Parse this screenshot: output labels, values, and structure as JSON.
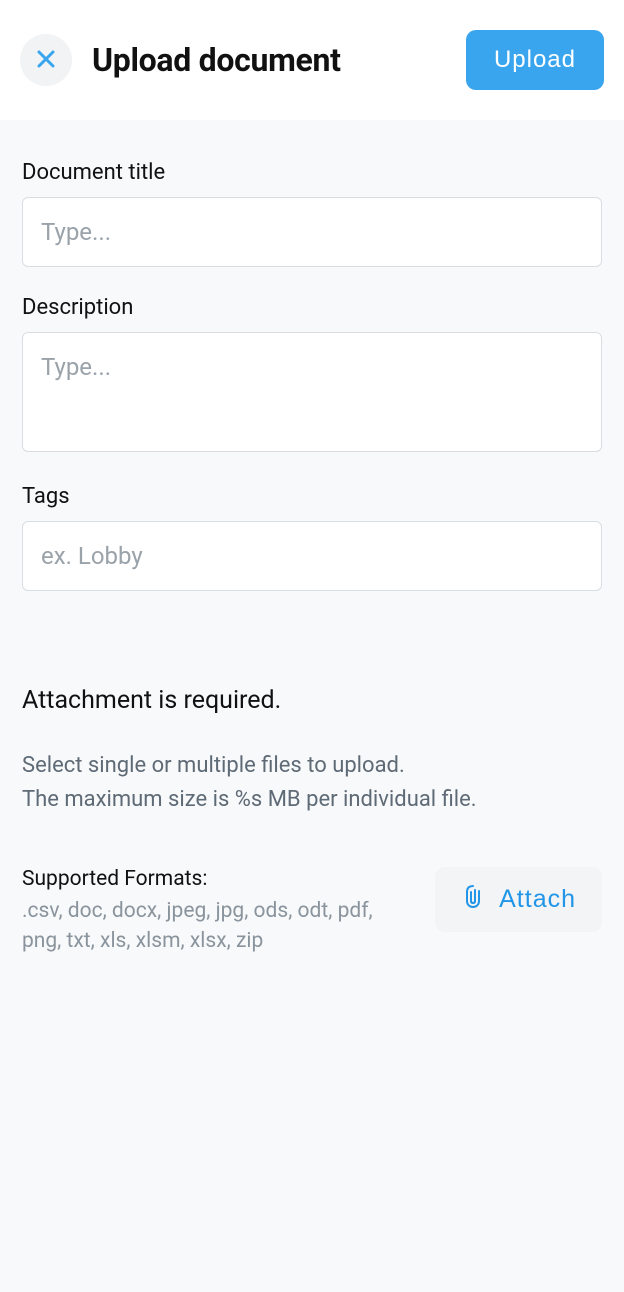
{
  "header": {
    "title": "Upload document",
    "upload_label": "Upload"
  },
  "form": {
    "title": {
      "label": "Document title",
      "placeholder": "Type...",
      "value": ""
    },
    "description": {
      "label": "Description",
      "placeholder": "Type...",
      "value": ""
    },
    "tags": {
      "label": "Tags",
      "placeholder": "ex. Lobby",
      "value": ""
    }
  },
  "attachment": {
    "required_text": "Attachment is required.",
    "help_line1": "Select single or multiple files to upload.",
    "help_line2": "The maximum size is %s MB per individual file.",
    "formats_title": "Supported Formats:",
    "formats_list": ".csv, doc, docx, jpeg, jpg, ods, odt, pdf, png, txt, xls, xlsm, xlsx, zip",
    "attach_label": "Attach"
  }
}
